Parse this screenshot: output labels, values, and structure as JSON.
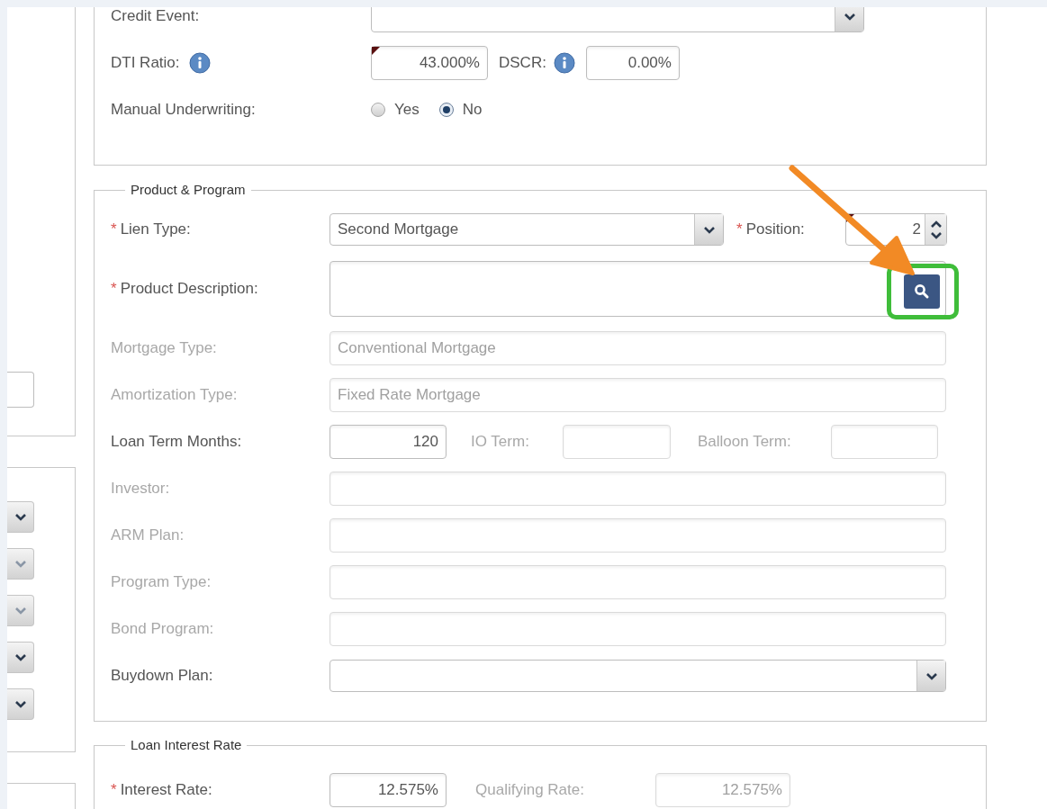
{
  "left_panel": {
    "dropdowns": [
      {
        "disabled": false
      },
      {
        "disabled": true
      },
      {
        "disabled": true
      },
      {
        "disabled": false
      },
      {
        "disabled": false
      }
    ]
  },
  "credit_section": {
    "credit_event": {
      "label": "Credit Event:"
    },
    "dti_ratio": {
      "label": "DTI Ratio:",
      "value": "43.000%",
      "flagged": true
    },
    "dscr": {
      "label": "DSCR:",
      "value": "0.00%",
      "flagged": false
    },
    "manual_underwriting": {
      "label": "Manual Underwriting:",
      "options": [
        {
          "label": "Yes",
          "selected": false
        },
        {
          "label": "No",
          "selected": true
        }
      ]
    }
  },
  "product_program": {
    "legend": "Product & Program",
    "rows": [
      {
        "kind": "select",
        "required_mark": "*",
        "label": "Lien Type:",
        "value": "Second Mortgage",
        "position": {
          "required_mark": "*",
          "label": "Position:",
          "value": "2",
          "flagged": true
        }
      },
      {
        "kind": "lookup",
        "required_mark": "*",
        "label": "Product Description:"
      },
      {
        "kind": "text",
        "label": "Mortgage Type:",
        "value": "Conventional Mortgage",
        "disabled": true
      },
      {
        "kind": "text",
        "label": "Amortization Type:",
        "value": "Fixed Rate Mortgage",
        "disabled": true
      },
      {
        "kind": "terms",
        "label": "Loan Term Months:",
        "value": "120",
        "disabled": false,
        "io_term": {
          "label": "IO Term:",
          "disabled": true
        },
        "balloon_term": {
          "label": "Balloon Term:",
          "disabled": true
        }
      },
      {
        "kind": "text",
        "label": "Investor:",
        "disabled": true
      },
      {
        "kind": "text",
        "label": "ARM Plan:",
        "disabled": true
      },
      {
        "kind": "text",
        "label": "Program Type:",
        "disabled": true
      },
      {
        "kind": "text",
        "label": "Bond Program:",
        "disabled": true
      },
      {
        "kind": "select",
        "label": "Buydown Plan:"
      }
    ]
  },
  "loan_interest_rate": {
    "legend": "Loan Interest Rate",
    "interest_rate": {
      "required_mark": "*",
      "label": "Interest Rate:",
      "value": "12.575%",
      "disabled": false
    },
    "qualifying_rate": {
      "label": "Qualifying Rate:",
      "value": "12.575%",
      "disabled": true
    }
  }
}
